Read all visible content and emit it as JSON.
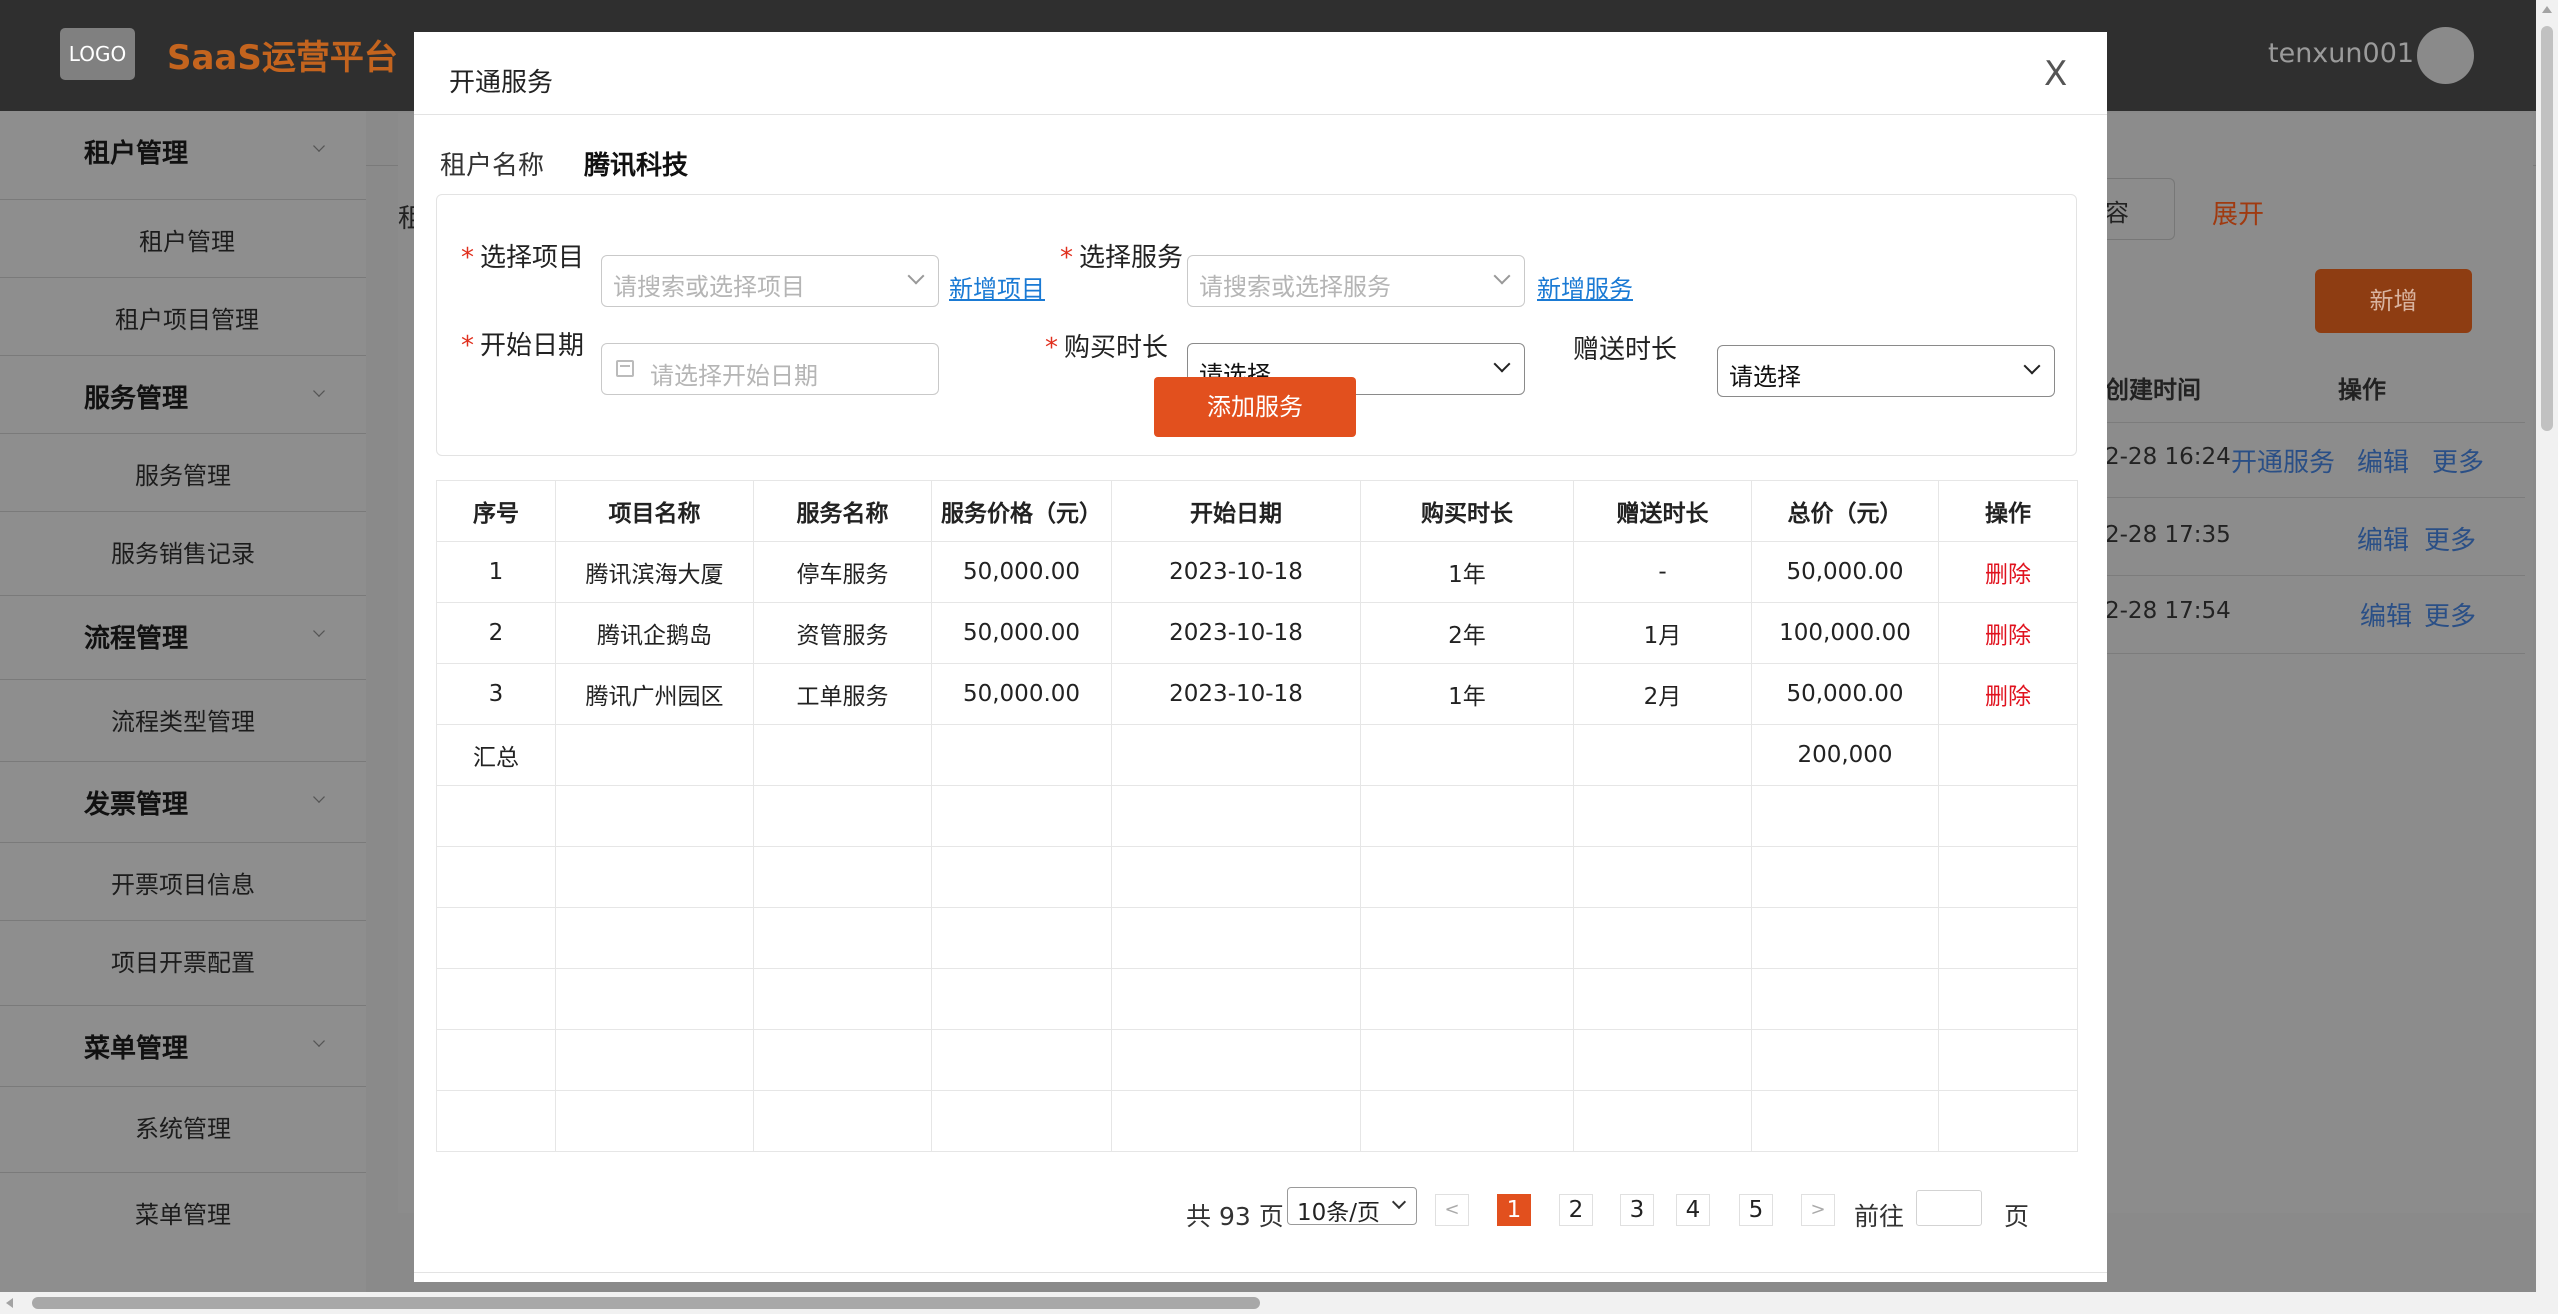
{
  "header": {
    "logo": "LOGO",
    "title": "SaaS运营平台",
    "username": "tenxun001"
  },
  "sidebar": {
    "groups": [
      {
        "label": "租户管理",
        "items": [
          "租户管理",
          "租户项目管理"
        ]
      },
      {
        "label": "服务管理",
        "items": [
          "服务管理",
          "服务销售记录"
        ]
      },
      {
        "label": "流程管理",
        "items": [
          "流程类型管理"
        ]
      },
      {
        "label": "发票管理",
        "items": [
          "开票项目信息",
          "项目开票配置"
        ]
      },
      {
        "label": "菜单管理",
        "items": [
          "系统管理",
          "菜单管理"
        ]
      }
    ]
  },
  "background": {
    "search_tail": "容",
    "expand": "展开",
    "new_button": "新增",
    "col_time": "创建时间",
    "col_op": "操作",
    "left_label": "租",
    "rows": [
      {
        "time": "2-28 16:24",
        "ops": [
          "开通服务",
          "编辑",
          "更多"
        ]
      },
      {
        "time": "2-28 17:35",
        "ops": [
          "编辑",
          "更多"
        ]
      },
      {
        "time": "2-28 17:54",
        "ops": [
          "编辑",
          "更多"
        ]
      }
    ]
  },
  "modal": {
    "title": "开通服务",
    "close": "X",
    "tenant_label": "租户名称",
    "tenant_value": "腾讯科技",
    "form": {
      "project_label": "选择项目",
      "project_placeholder": "请搜索或选择项目",
      "add_project_link": "新增项目",
      "service_label": "选择服务",
      "service_placeholder": "请搜索或选择服务",
      "add_service_link": "新增服务",
      "start_date_label": "开始日期",
      "start_date_placeholder": "请选择开始日期",
      "duration_label": "购买时长",
      "duration_value": "请选择",
      "gift_label": "赠送时长",
      "gift_value": "请选择",
      "add_button": "添加服务",
      "required_mark": "*"
    },
    "table": {
      "headers": [
        "序号",
        "项目名称",
        "服务名称",
        "服务价格（元）",
        "开始日期",
        "购买时长",
        "赠送时长",
        "总价（元）",
        "操作"
      ],
      "rows": [
        [
          "1",
          "腾讯滨海大厦",
          "停车服务",
          "50,000.00",
          "2023-10-18",
          "1年",
          "-",
          "50,000.00",
          "删除"
        ],
        [
          "2",
          "腾讯企鹅岛",
          "资管服务",
          "50,000.00",
          "2023-10-18",
          "2年",
          "1月",
          "100,000.00",
          "删除"
        ],
        [
          "3",
          "腾讯广州园区",
          "工单服务",
          "50,000.00",
          "2023-10-18",
          "1年",
          "2月",
          "50,000.00",
          "删除"
        ]
      ],
      "summary_label": "汇总",
      "summary_total": "200,000"
    },
    "pagination": {
      "total_text": "共 93 页",
      "page_size": "10条/页",
      "prev": "<",
      "next": ">",
      "pages": [
        "1",
        "2",
        "3",
        "4",
        "5"
      ],
      "current": "1",
      "goto_label": "前往",
      "page_suffix": "页"
    }
  }
}
